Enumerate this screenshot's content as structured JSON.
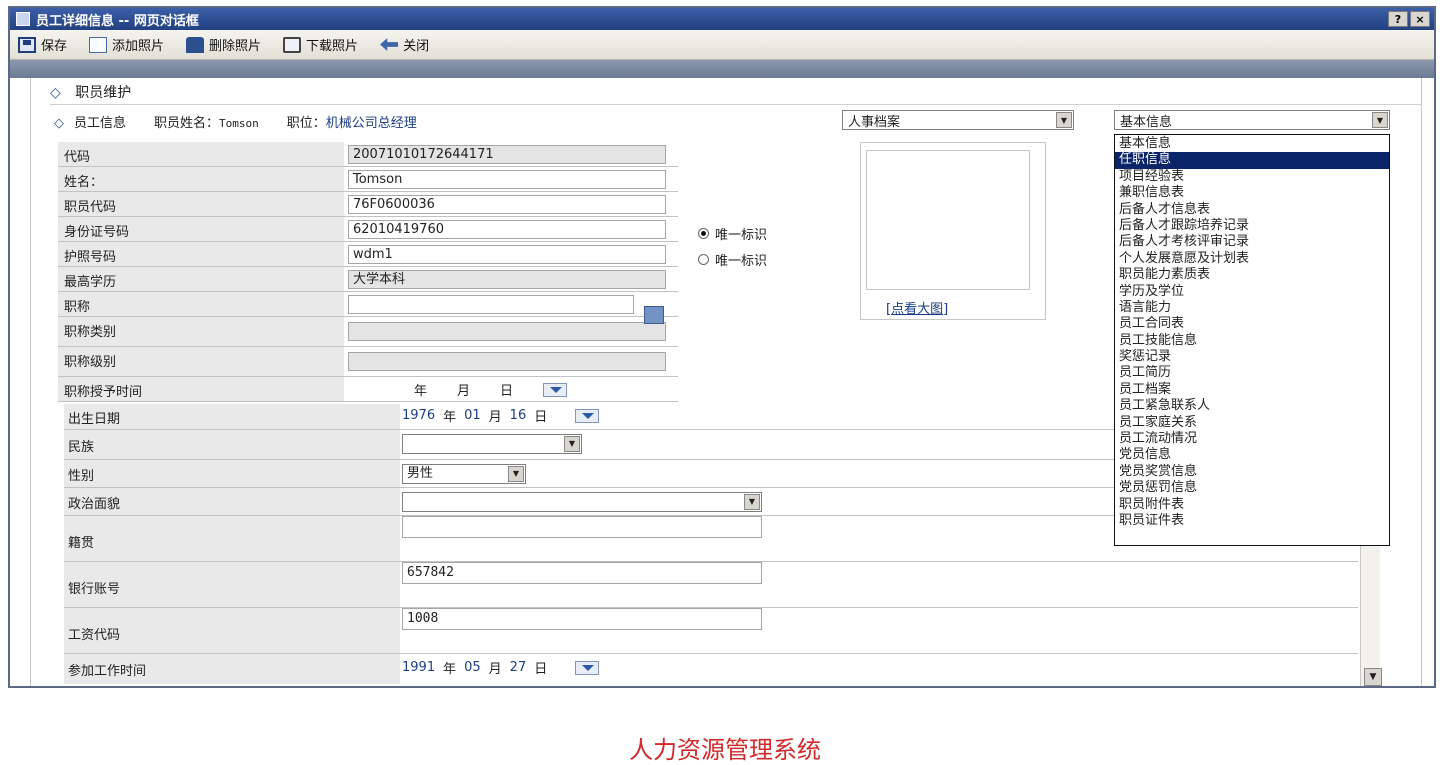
{
  "window": {
    "title": "员工详细信息 -- 网页对话框",
    "help_btn": "?",
    "close_btn": "×"
  },
  "toolbar": {
    "save": "保存",
    "add_photo": "添加照片",
    "delete_photo": "删除照片",
    "download_photo": "下载照片",
    "close": "关闭"
  },
  "section": {
    "title": "职员维护"
  },
  "info": {
    "label": "员工信息",
    "name_label": "职员姓名：",
    "name_value": "Tomson",
    "position_label": "职位：",
    "position_value": "机械公司总经理"
  },
  "combos": {
    "archive": "人事档案",
    "category": "基本信息"
  },
  "dropdown_options": [
    "基本信息",
    "任职信息",
    "项目经验表",
    "兼职信息表",
    "后备人才信息表",
    "后备人才跟踪培养记录",
    "后备人才考核评审记录",
    "个人发展意愿及计划表",
    "职员能力素质表",
    "学历及学位",
    "语言能力",
    "员工合同表",
    "员工技能信息",
    "奖惩记录",
    "员工简历",
    "员工档案",
    "员工紧急联系人",
    "员工家庭关系",
    "员工流动情况",
    "党员信息",
    "党员奖赏信息",
    "党员惩罚信息",
    "职员附件表",
    "职员证件表"
  ],
  "dropdown_selected": "任职信息",
  "fields": {
    "code": {
      "label": "代码",
      "value": "20071010172644171"
    },
    "name": {
      "label": "姓名：",
      "value": "Tomson"
    },
    "emp_code": {
      "label": "职员代码",
      "value": "76F0600036"
    },
    "id_number": {
      "label": "身份证号码",
      "value": "62010419760"
    },
    "passport": {
      "label": "护照号码",
      "value": "wdm1"
    },
    "education": {
      "label": "最高学历",
      "value": "大学本科"
    },
    "title": {
      "label": "职称",
      "value": ""
    },
    "title_type": {
      "label": "职称类别",
      "value": ""
    },
    "title_level": {
      "label": "职称级别",
      "value": ""
    },
    "title_date": {
      "label": "职称授予时间",
      "year": "年",
      "month": "月",
      "day": "日"
    }
  },
  "radios": {
    "id_unique": "唯一标识",
    "passport_unique": "唯一标识"
  },
  "photo": {
    "link": "[点看大图]"
  },
  "fields2": {
    "birth": {
      "label": "出生日期",
      "year": "1976",
      "y": "年",
      "month": "01",
      "m": "月",
      "day": "16",
      "d": "日"
    },
    "ethnic": {
      "label": "民族",
      "value": ""
    },
    "gender": {
      "label": "性别",
      "value": "男性"
    },
    "political": {
      "label": "政治面貌",
      "value": ""
    },
    "hometown": {
      "label": "籍贯",
      "value": ""
    },
    "bank": {
      "label": "银行账号",
      "value": "657842"
    },
    "salary_code": {
      "label": "工资代码",
      "value": "1008"
    },
    "work_start": {
      "label": "参加工作时间",
      "year": "1991",
      "y": "年",
      "month": "05",
      "m": "月",
      "day": "27",
      "d": "日"
    }
  },
  "caption": "人力资源管理系统"
}
